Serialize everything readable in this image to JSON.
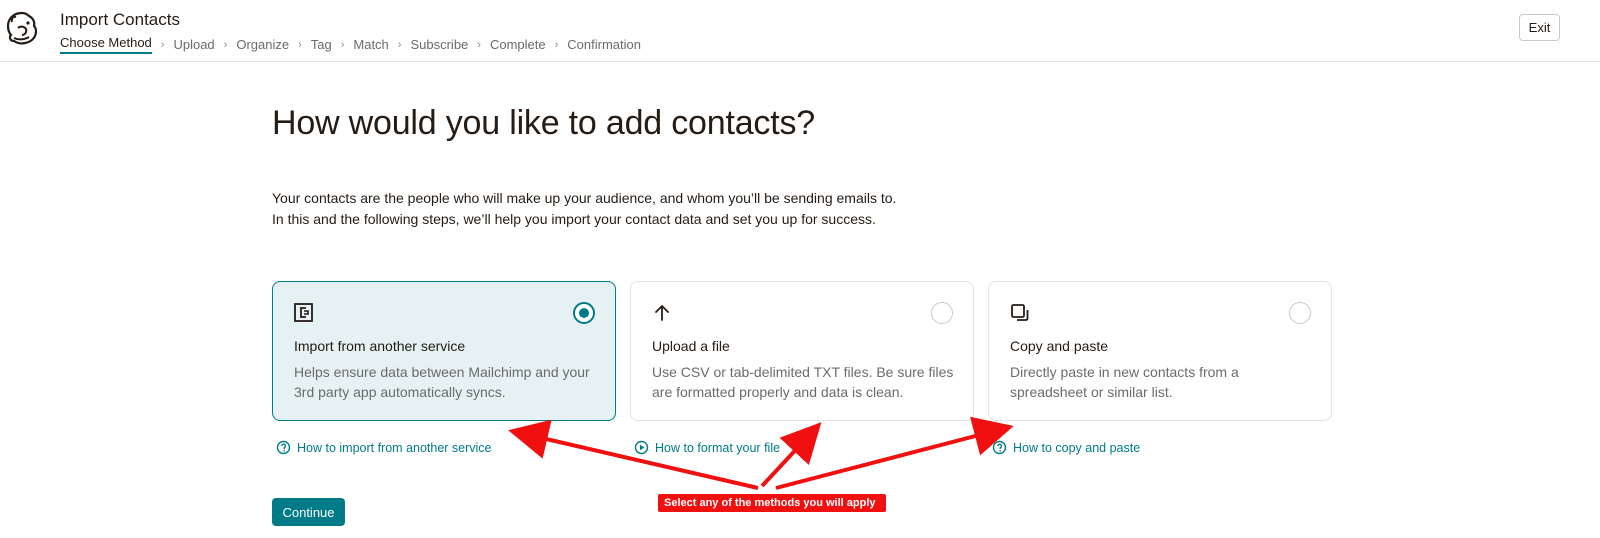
{
  "header": {
    "title": "Import Contacts",
    "steps": [
      "Choose Method",
      "Upload",
      "Organize",
      "Tag",
      "Match",
      "Subscribe",
      "Complete",
      "Confirmation"
    ],
    "step_separator": "›",
    "exit_label": "Exit",
    "logo_icon": "mailchimp-freddie-logo"
  },
  "main": {
    "heading": "How would you like to add contacts?",
    "intro_line1": "Your contacts are the people who will make up your audience, and whom you’ll be sending emails to.",
    "intro_line2": "In this and the following steps, we’ll help you import your contact data and set you up for success."
  },
  "cards": [
    {
      "icon": "integration-icon",
      "title": "Import from another service",
      "desc": "Helps ensure data between Mailchimp and your 3rd party app automatically syncs.",
      "selected": true,
      "help_link": "How to import from another service",
      "help_icon": "lightbulb-icon"
    },
    {
      "icon": "upload-arrow-icon",
      "title": "Upload a file",
      "desc": "Use CSV or tab-delimited TXT files. Be sure files are formatted properly and data is clean.",
      "selected": false,
      "help_link": "How to format your file",
      "help_icon": "play-circle-icon"
    },
    {
      "icon": "copy-icon",
      "title": "Copy and paste",
      "desc": "Directly paste in new contacts from a spreadsheet or similar list.",
      "selected": false,
      "help_link": "How to copy and paste",
      "help_icon": "lightbulb-icon"
    }
  ],
  "continue_label": "Continue",
  "annotation": {
    "text": "Select any of the methods you will apply",
    "color": "#f01010"
  },
  "colors": {
    "accent": "#007c89",
    "selected_bg": "#e5f1f2",
    "text": "#241c15",
    "muted": "#6b6b6b"
  }
}
